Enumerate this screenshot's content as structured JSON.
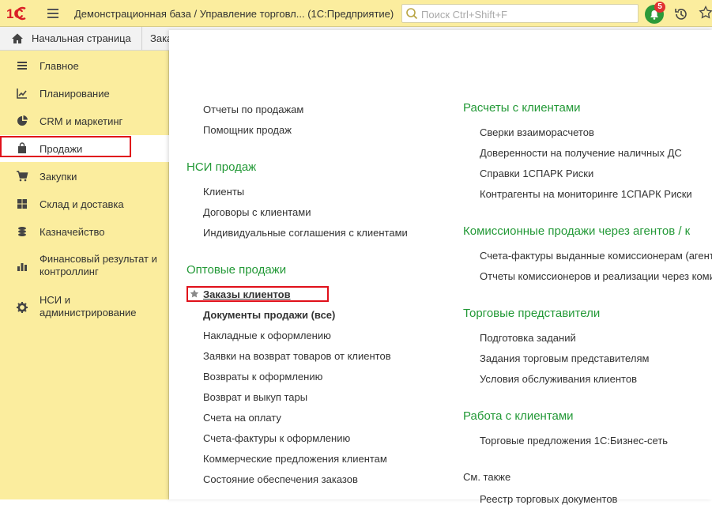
{
  "titlebar": {
    "title": "Демонстрационная база / Управление торговл...  (1С:Предприятие)",
    "search_placeholder": "Поиск Ctrl+Shift+F",
    "notification_count": "5"
  },
  "tabs": {
    "home": "Начальная страница",
    "second": "Зака"
  },
  "sidebar": {
    "items": [
      {
        "label": "Главное",
        "icon": "menu-lines-icon"
      },
      {
        "label": "Планирование",
        "icon": "planning-icon"
      },
      {
        "label": "CRM и маркетинг",
        "icon": "pie-chart-icon"
      },
      {
        "label": "Продажи",
        "icon": "shopping-bag-icon"
      },
      {
        "label": "Закупки",
        "icon": "cart-icon"
      },
      {
        "label": "Склад и доставка",
        "icon": "grid-icon"
      },
      {
        "label": "Казначейство",
        "icon": "coins-icon"
      },
      {
        "label": "Финансовый результат и",
        "label2": "контроллинг",
        "icon": "bar-chart-icon"
      },
      {
        "label": "НСИ и",
        "label2": "администрирование",
        "icon": "gear-icon"
      }
    ]
  },
  "left_col": {
    "top_links": [
      "Отчеты по продажам",
      "Помощник продаж"
    ],
    "nsi_header": "НСИ продаж",
    "nsi_links": [
      "Клиенты",
      "Договоры с клиентами",
      "Индивидуальные соглашения с клиентами"
    ],
    "wholesale_header": "Оптовые продажи",
    "orders_link": "Заказы клиентов",
    "wholesale_links": [
      "Документы продажи (все)",
      "Накладные к оформлению",
      "Заявки на возврат товаров от клиентов",
      "Возвраты к оформлению",
      "Возврат и выкуп тары",
      "Счета на оплату",
      "Счета-фактуры к оформлению",
      "Коммерческие предложения клиентам",
      "Состояние обеспечения заказов"
    ]
  },
  "right_col": {
    "settlements_header": "Расчеты с клиентами",
    "settlements_links": [
      "Сверки взаиморасчетов",
      "Доверенности на получение наличных ДС",
      "Справки 1СПАРК Риски",
      "Контрагенты на мониторинге 1СПАРК Риски"
    ],
    "commission_header": "Комиссионные продажи через агентов / к",
    "commission_links": [
      "Счета-фактуры выданные комиссионерам (агента",
      "Отчеты комиссионеров и реализации через коми"
    ],
    "reps_header": "Торговые представители",
    "reps_links": [
      "Подготовка заданий",
      "Задания торговым представителям",
      "Условия обслуживания клиентов"
    ],
    "clients_header": "Работа с клиентами",
    "clients_links": [
      "Торговые предложения 1С:Бизнес-сеть"
    ],
    "see_also": "См. также",
    "see_also_links": [
      "Реестр торговых документов"
    ]
  },
  "colors": {
    "accent_green": "#239937",
    "sidebar_bg": "#fbed9e",
    "highlight_red": "#e0101a"
  }
}
